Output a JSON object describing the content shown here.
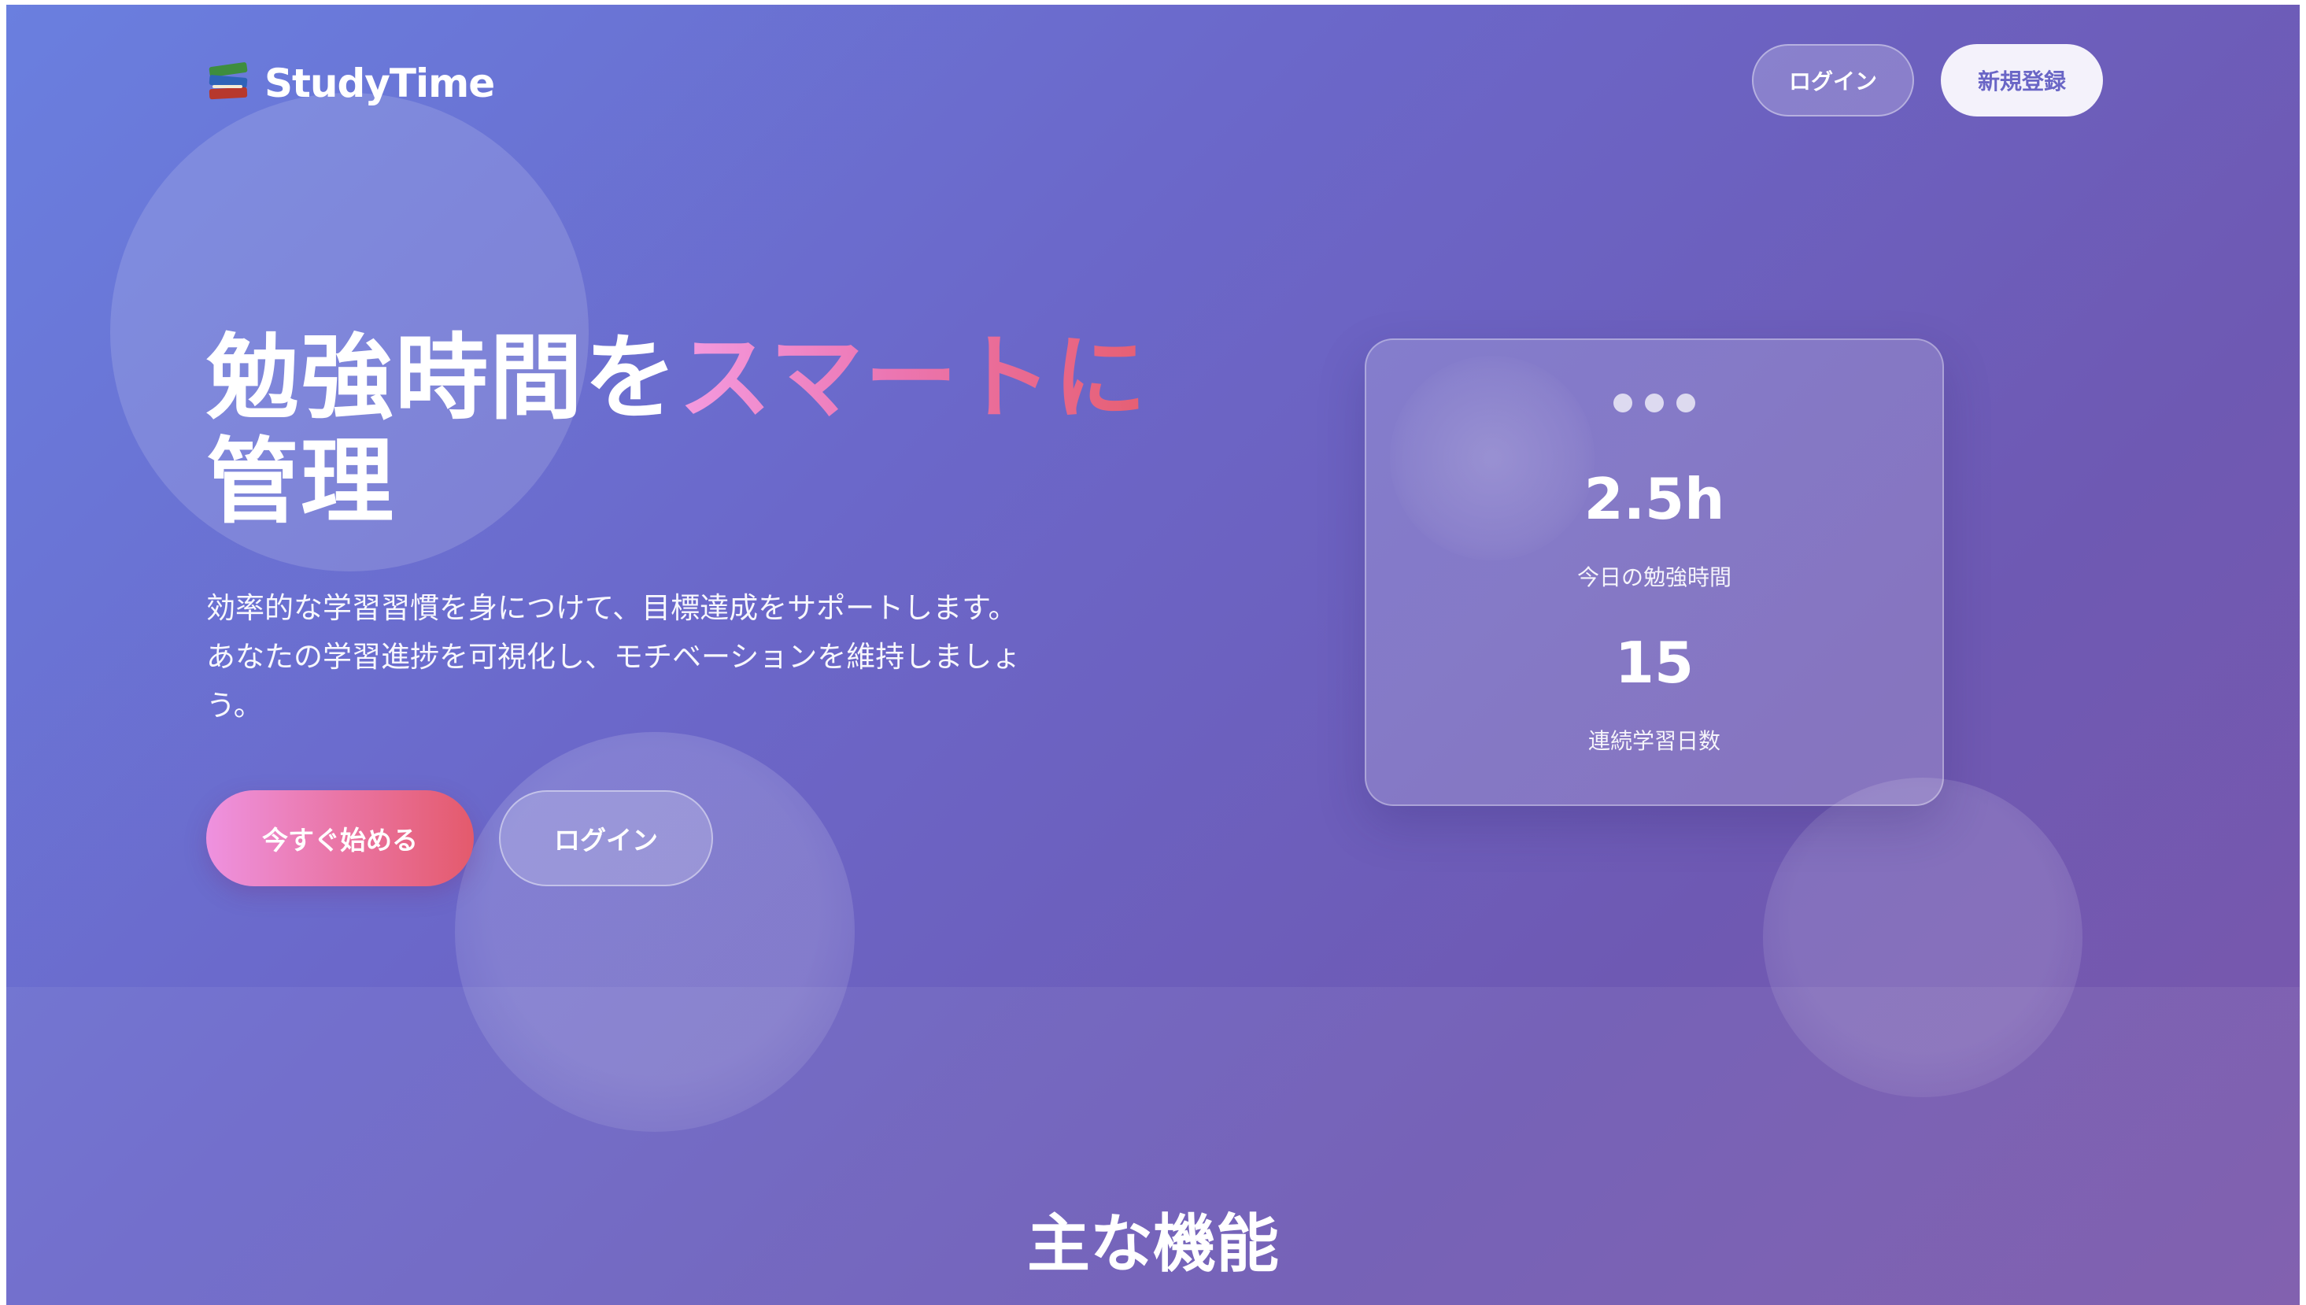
{
  "header": {
    "brand": "StudyTime",
    "brand_icon": "books-icon",
    "nav": {
      "login_label": "ログイン",
      "signup_label": "新規登録"
    }
  },
  "hero": {
    "title_main": "勉強時間を",
    "title_accent": "スマートに",
    "title_line2": "管理",
    "description_line1": "効率的な学習習慣を身につけて、目標達成をサポートします。",
    "description_line2": "あなたの学習進捗を可視化し、モチベーションを維持しましょ",
    "description_line3": "う。",
    "cta_primary": "今すぐ始める",
    "cta_secondary": "ログイン"
  },
  "stats_card": {
    "today_value": "2.5h",
    "today_label": "今日の勉強時間",
    "streak_value": "15",
    "streak_label": "連続学習日数"
  },
  "features": {
    "title": "主な機能"
  },
  "colors": {
    "gradient_start": "#6a7fdf",
    "gradient_end": "#7b58ab",
    "accent_pink": "#ec76b2",
    "accent_red": "#e65f72",
    "signup_text": "#6a66c6"
  }
}
